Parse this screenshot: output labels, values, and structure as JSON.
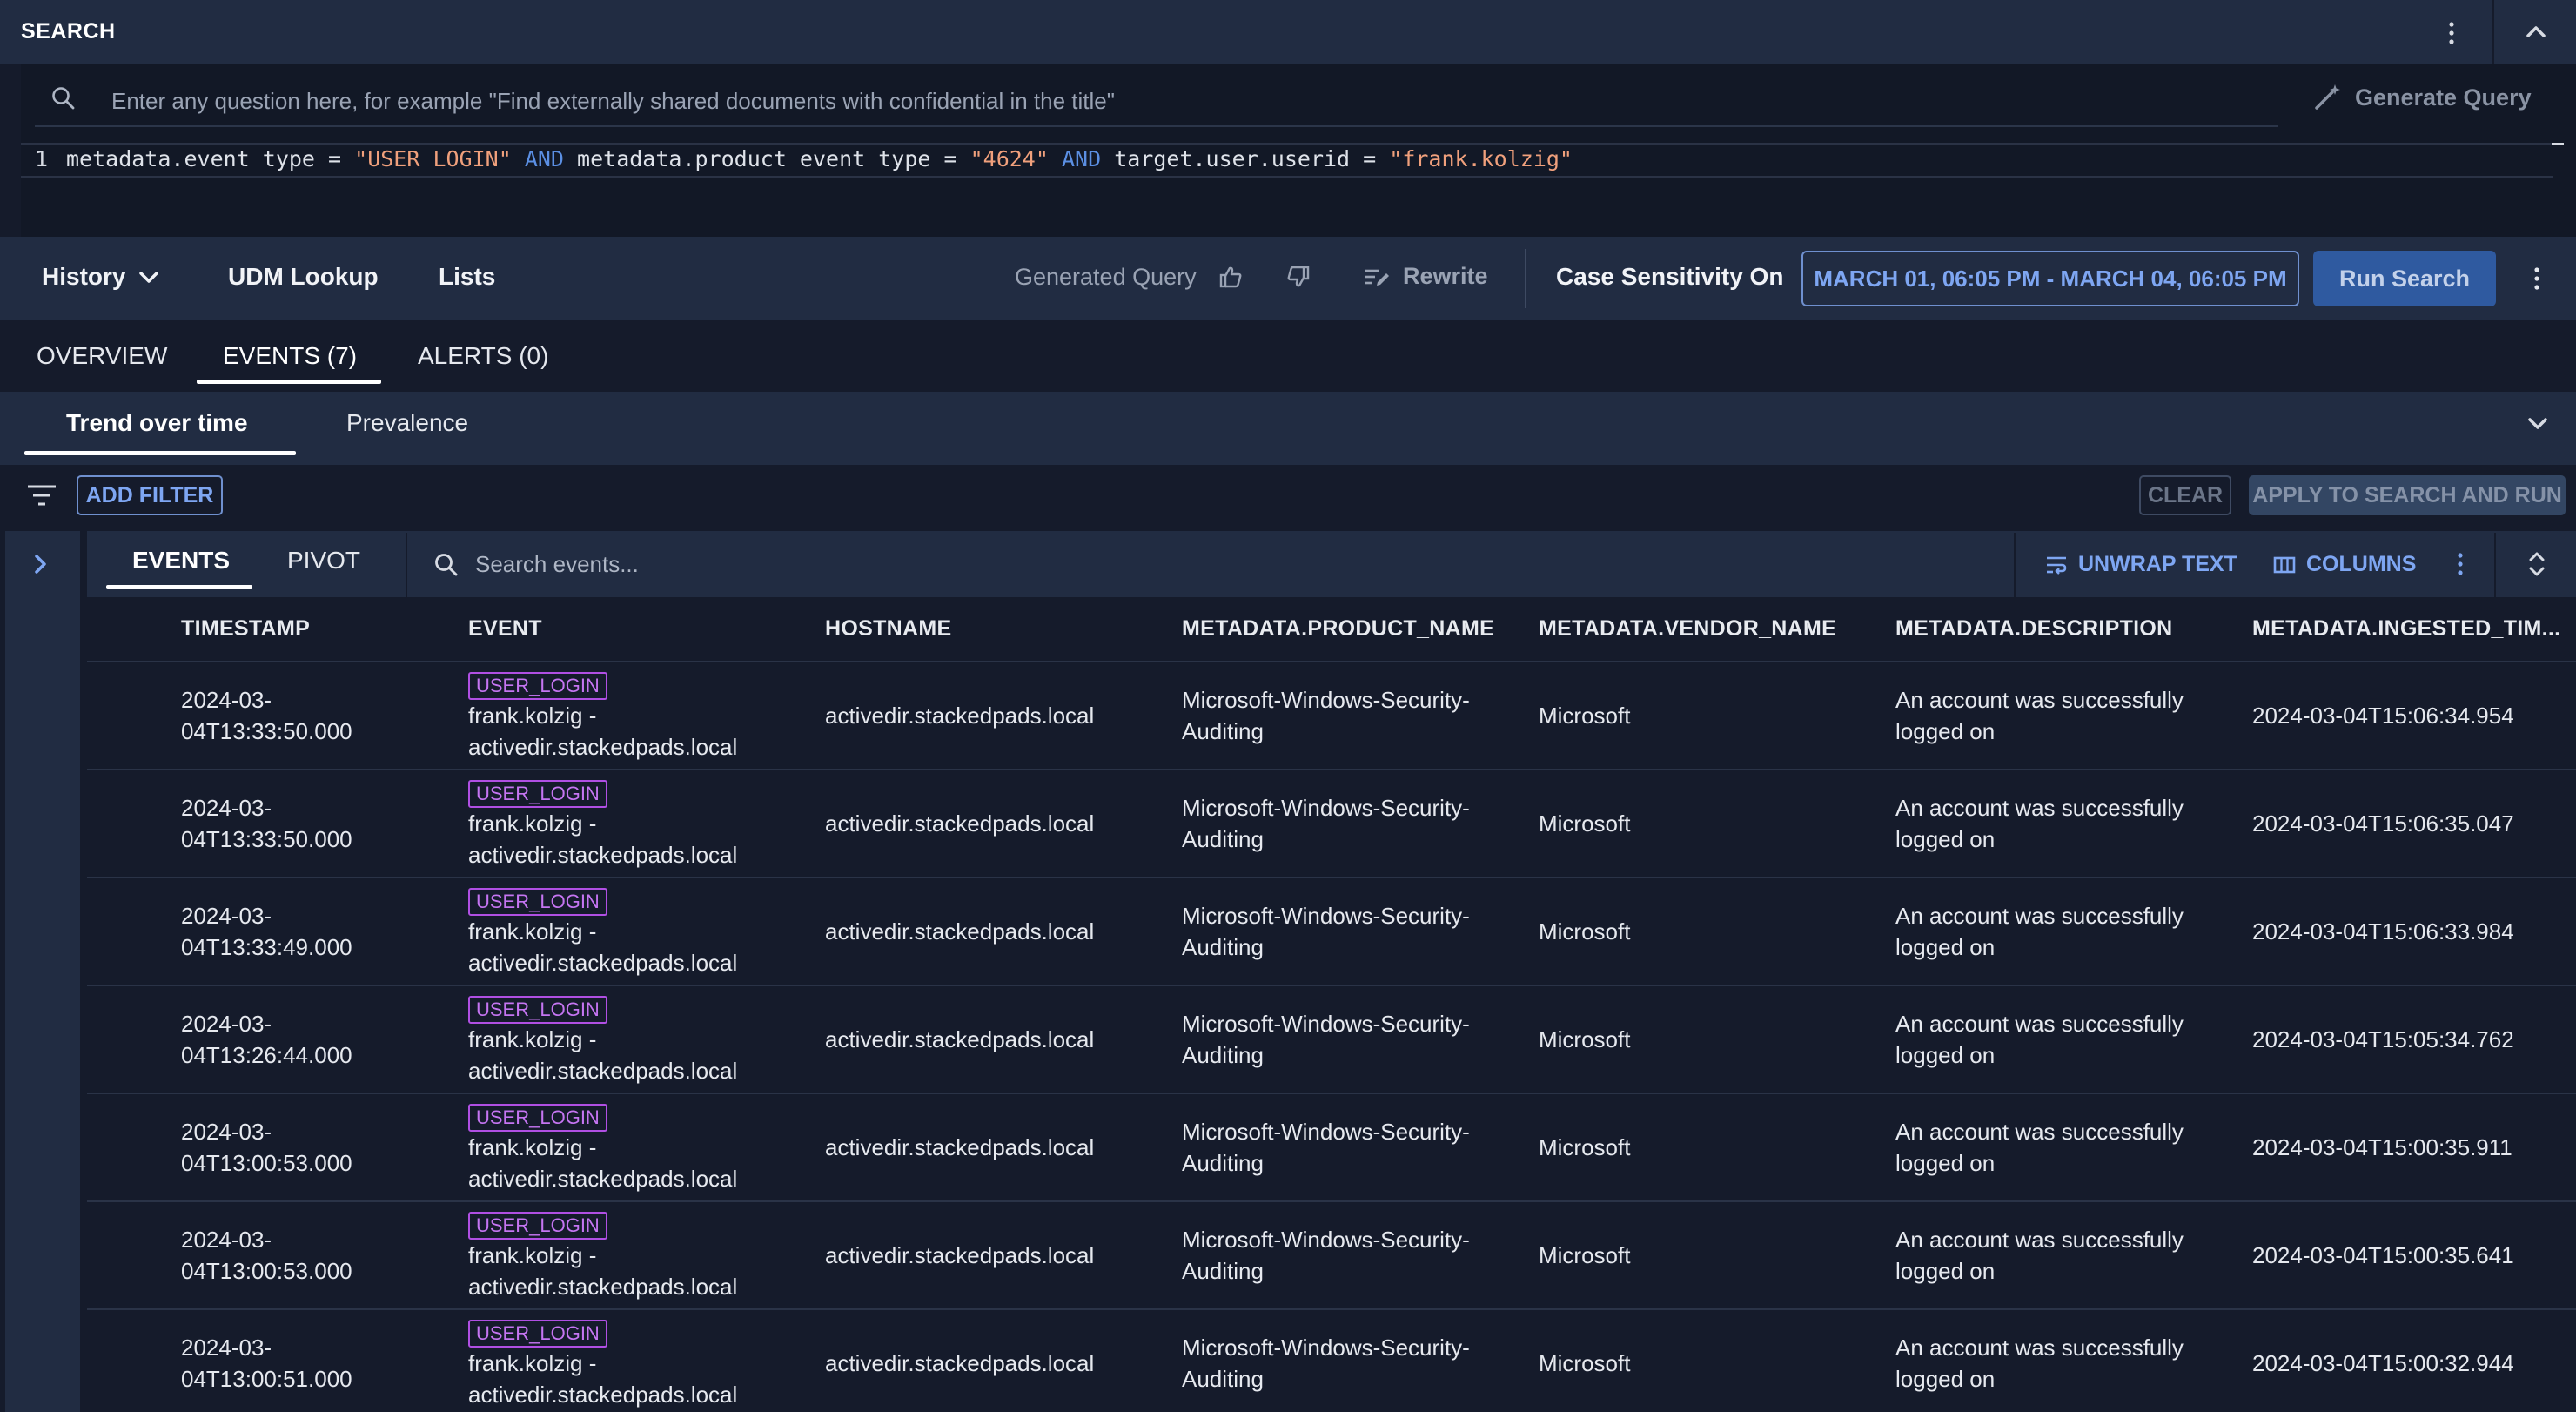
{
  "search_header": {
    "title": "SEARCH"
  },
  "query": {
    "nl_placeholder": "Enter any question here, for example \"Find externally shared documents with confidential in the title\"",
    "generate_label": "Generate Query",
    "line_number": "1",
    "udm_tokens": {
      "f1": "metadata.event_type = ",
      "s1": "\"USER_LOGIN\"",
      "k1": "AND",
      "f2": "metadata.product_event_type = ",
      "s2": "\"4624\"",
      "k2": "AND",
      "f3": "target.user.userid = ",
      "s3": "\"frank.kolzig\""
    }
  },
  "toolbar": {
    "history": "History",
    "udm_lookup": "UDM Lookup",
    "lists": "Lists",
    "generated_query": "Generated Query",
    "rewrite": "Rewrite",
    "case_sensitivity": "Case Sensitivity On",
    "date_range": "MARCH 01, 06:05 PM - MARCH 04, 06:05 PM",
    "run_search": "Run Search"
  },
  "tabs": {
    "overview": "OVERVIEW",
    "events": "EVENTS (7)",
    "alerts": "ALERTS (0)"
  },
  "subtabs": {
    "trend": "Trend over time",
    "prevalence": "Prevalence"
  },
  "filter_bar": {
    "add_filter": "ADD FILTER",
    "clear": "CLEAR",
    "apply": "APPLY TO SEARCH AND RUN"
  },
  "events_panel": {
    "tab_events": "EVENTS",
    "tab_pivot": "PIVOT",
    "search_placeholder": "Search events...",
    "unwrap_text": "UNWRAP TEXT",
    "columns": "COLUMNS"
  },
  "table": {
    "columns": [
      "TIMESTAMP",
      "EVENT",
      "HOSTNAME",
      "METADATA.PRODUCT_NAME",
      "METADATA.VENDOR_NAME",
      "METADATA.DESCRIPTION",
      "METADATA.INGESTED_TIM..."
    ],
    "rows": [
      {
        "ts1": "2024-03-",
        "ts2": "04T13:33:50.000",
        "badge": "USER_LOGIN",
        "ev1": "frank.kolzig -",
        "ev2": "activedir.stackedpads.local",
        "host": "activedir.stackedpads.local",
        "pn1": "Microsoft-Windows-Security-",
        "pn2": "Auditing",
        "vendor": "Microsoft",
        "d1": "An account was successfully",
        "d2": "logged on",
        "ingested": "2024-03-04T15:06:34.954"
      },
      {
        "ts1": "2024-03-",
        "ts2": "04T13:33:50.000",
        "badge": "USER_LOGIN",
        "ev1": "frank.kolzig -",
        "ev2": "activedir.stackedpads.local",
        "host": "activedir.stackedpads.local",
        "pn1": "Microsoft-Windows-Security-",
        "pn2": "Auditing",
        "vendor": "Microsoft",
        "d1": "An account was successfully",
        "d2": "logged on",
        "ingested": "2024-03-04T15:06:35.047"
      },
      {
        "ts1": "2024-03-",
        "ts2": "04T13:33:49.000",
        "badge": "USER_LOGIN",
        "ev1": "frank.kolzig -",
        "ev2": "activedir.stackedpads.local",
        "host": "activedir.stackedpads.local",
        "pn1": "Microsoft-Windows-Security-",
        "pn2": "Auditing",
        "vendor": "Microsoft",
        "d1": "An account was successfully",
        "d2": "logged on",
        "ingested": "2024-03-04T15:06:33.984"
      },
      {
        "ts1": "2024-03-",
        "ts2": "04T13:26:44.000",
        "badge": "USER_LOGIN",
        "ev1": "frank.kolzig -",
        "ev2": "activedir.stackedpads.local",
        "host": "activedir.stackedpads.local",
        "pn1": "Microsoft-Windows-Security-",
        "pn2": "Auditing",
        "vendor": "Microsoft",
        "d1": "An account was successfully",
        "d2": "logged on",
        "ingested": "2024-03-04T15:05:34.762"
      },
      {
        "ts1": "2024-03-",
        "ts2": "04T13:00:53.000",
        "badge": "USER_LOGIN",
        "ev1": "frank.kolzig -",
        "ev2": "activedir.stackedpads.local",
        "host": "activedir.stackedpads.local",
        "pn1": "Microsoft-Windows-Security-",
        "pn2": "Auditing",
        "vendor": "Microsoft",
        "d1": "An account was successfully",
        "d2": "logged on",
        "ingested": "2024-03-04T15:00:35.911"
      },
      {
        "ts1": "2024-03-",
        "ts2": "04T13:00:53.000",
        "badge": "USER_LOGIN",
        "ev1": "frank.kolzig -",
        "ev2": "activedir.stackedpads.local",
        "host": "activedir.stackedpads.local",
        "pn1": "Microsoft-Windows-Security-",
        "pn2": "Auditing",
        "vendor": "Microsoft",
        "d1": "An account was successfully",
        "d2": "logged on",
        "ingested": "2024-03-04T15:00:35.641"
      },
      {
        "ts1": "2024-03-",
        "ts2": "04T13:00:51.000",
        "badge": "USER_LOGIN",
        "ev1": "frank.kolzig -",
        "ev2": "activedir.stackedpads.local",
        "host": "activedir.stackedpads.local",
        "pn1": "Microsoft-Windows-Security-",
        "pn2": "Auditing",
        "vendor": "Microsoft",
        "d1": "An account was successfully",
        "d2": "logged on",
        "ingested": "2024-03-04T15:00:32.944"
      }
    ]
  },
  "icons": {
    "search": "search-icon",
    "generate": "magic-pen-icon",
    "kebab": "kebab-menu-icon",
    "collapse": "chevron-up-icon",
    "history_dropdown": "chevron-down-icon",
    "thumbs_up": "thumbs-up-icon",
    "thumbs_down": "thumbs-down-icon",
    "rewrite": "rewrite-icon",
    "filter": "filter-icon",
    "expand_panel": "chevron-right-icon",
    "unwrap": "wrap-text-icon",
    "columns": "columns-icon",
    "expand_collapse": "unfold-icon"
  },
  "colors": {
    "accent": "#7ea6f2",
    "badge": "#b04fe3",
    "primary_button": "#2f5aa0"
  }
}
